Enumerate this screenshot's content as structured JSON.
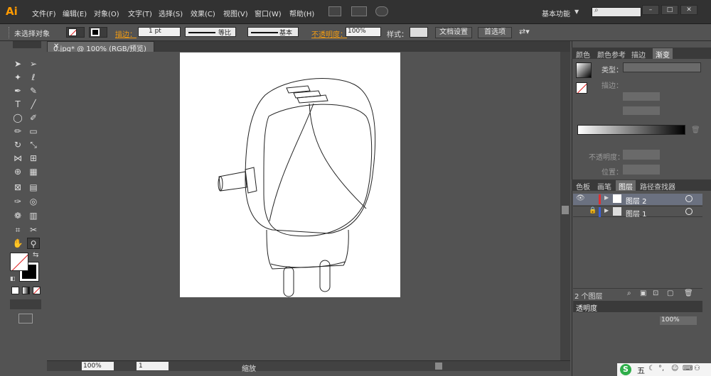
{
  "menubar": {
    "logo": "Ai",
    "items": [
      "文件(F)",
      "编辑(E)",
      "对象(O)",
      "文字(T)",
      "选择(S)",
      "效果(C)",
      "视图(V)",
      "窗口(W)",
      "帮助(H)"
    ],
    "workspace": "基本功能",
    "search_icon": "search-icon",
    "window_controls": [
      "–",
      "□",
      "✕"
    ]
  },
  "controlbar": {
    "selection_status": "未选择对象",
    "stroke_label": "描边：",
    "stroke_weight": "1 pt",
    "stroke_profile": "等比",
    "brush_label": "基本",
    "opacity_label": "不透明度：",
    "opacity_value": "100%",
    "style_label": "样式：",
    "doc_setup_button": "文档设置",
    "preferences_button": "首选项"
  },
  "document": {
    "tab_title": "0.jpg* @ 100% (RGB/预览)",
    "close": "✕"
  },
  "statusbar": {
    "zoom": "100%",
    "page": "1",
    "status": "缩放"
  },
  "gradient_panel": {
    "tabs": [
      "颜色",
      "颜色参考",
      "描边",
      "渐变"
    ],
    "type_label": "类型：",
    "stroke_label": "描边：",
    "opacity_label": "不透明度：",
    "position_label": "位置："
  },
  "layers_panel": {
    "tabs": [
      "色板",
      "画笔",
      "图层",
      "路径查找器"
    ],
    "layers": [
      {
        "name": "图层 2",
        "color": "#e03030"
      },
      {
        "name": "图层 1",
        "color": "#3a5fd6"
      }
    ],
    "count": "2 个图层"
  },
  "transparency_panel": {
    "title": "透明度",
    "value": "100%"
  },
  "taskbar": {
    "ime": "五"
  },
  "colors": {
    "accent_orange": "#f39c12",
    "ai_logo": "#ff9a00",
    "panel_bg": "#535353",
    "menubar_bg": "#323232"
  }
}
